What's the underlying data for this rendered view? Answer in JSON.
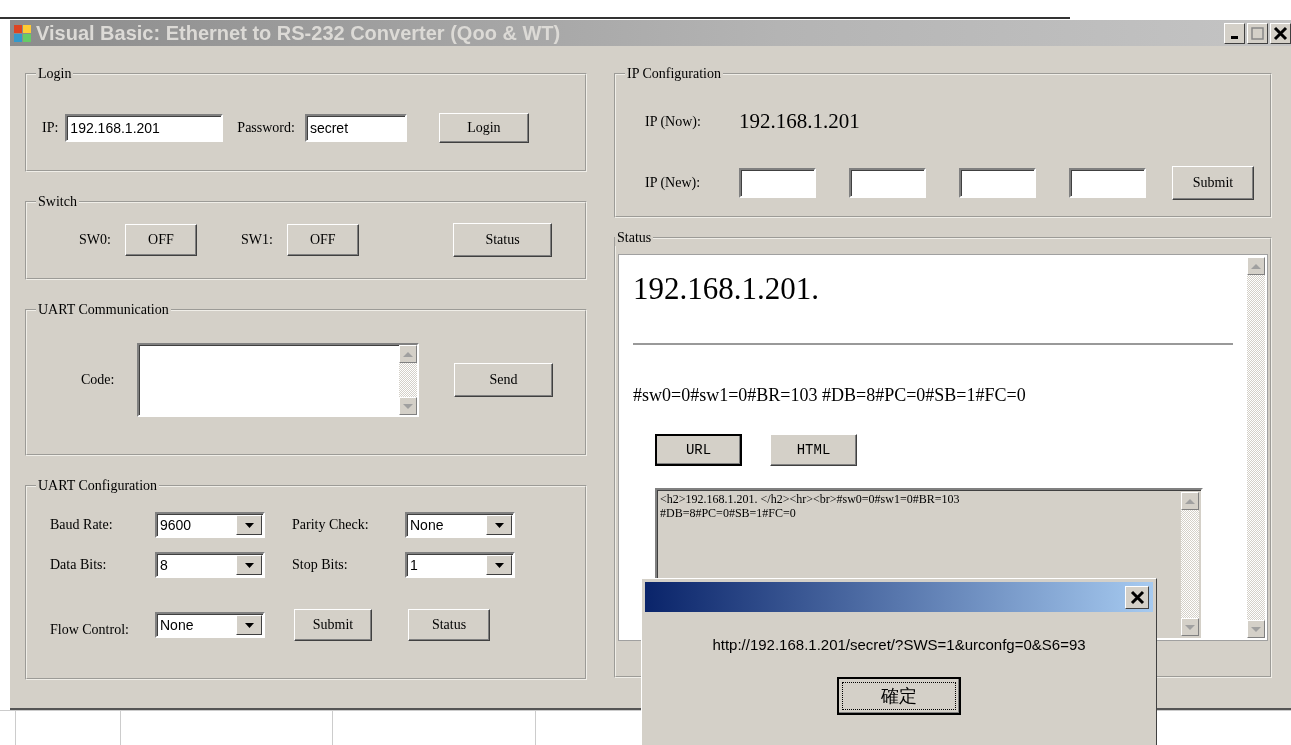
{
  "window": {
    "title": "Visual Basic: Ethernet to RS-232 Converter (Qoo & WT)",
    "active": false
  },
  "login": {
    "title": "Login",
    "ip_label": "IP:",
    "ip": "192.168.1.201",
    "password_label": "Password:",
    "password": "secret",
    "button": "Login"
  },
  "switch": {
    "title": "Switch",
    "switches": [
      {
        "label": "SW0:",
        "button": "OFF"
      },
      {
        "label": "SW1:",
        "button": "OFF"
      }
    ],
    "status_button": "Status"
  },
  "uart_communication": {
    "title": "UART Communication",
    "code_label": "Code:",
    "button": "Send"
  },
  "uart_configuration": {
    "title": "UART Configuration",
    "fields": [
      {
        "label": "Baud Rate:",
        "value": "9600"
      },
      {
        "label": "Parity Check:",
        "value": "None"
      },
      {
        "label": "Data Bits:",
        "value": "8"
      },
      {
        "label": "Stop Bits:",
        "value": "1"
      },
      {
        "label": "Flow Control:",
        "value": "None"
      }
    ],
    "buttons": [
      "Submit",
      "Status"
    ]
  },
  "ip_configuration": {
    "title": "IP Configuration",
    "now_label": "IP (Now):",
    "now_value": "192.168.1.201",
    "new_label": "IP (New):",
    "new_fields": [
      {
        "kind": "octet"
      },
      {
        "kind": "octet"
      },
      {
        "kind": "octet"
      },
      {
        "kind": "octet"
      }
    ],
    "button": "Submit"
  },
  "status": {
    "title": "Status",
    "heading": "192.168.1.201.",
    "body": "#sw0=0#sw1=0#BR=103 #DB=8#PC=0#SB=1#FC=0",
    "buttons": [
      {
        "label": "URL",
        "focused": true
      },
      {
        "label": "HTML",
        "focused": false
      }
    ],
    "source": "<h2>192.168.1.201. </h2><hr><br>#sw0=0#sw1=0#BR=103\n#DB=8#PC=0#SB=1#FC=0"
  },
  "dialog": {
    "message": "http://192.168.1.201/secret/?SWS=1&urconfg=0&S6=93",
    "button": "確定"
  }
}
